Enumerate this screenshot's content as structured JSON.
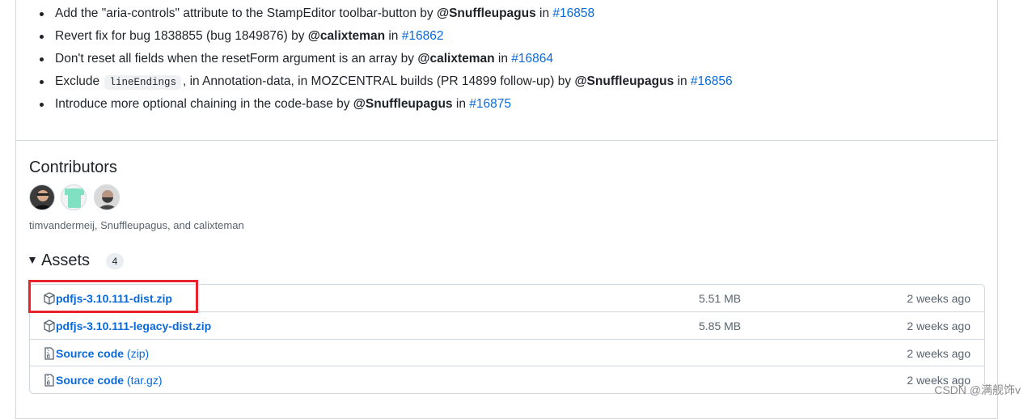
{
  "changes": [
    {
      "pre": "Add the \"aria-controls\" attribute to the StampEditor toolbar-button by ",
      "author": "@Snuffleupagus",
      "mid": " in ",
      "pr": "#16858"
    },
    {
      "pre": "Revert fix for bug 1838855 (bug 1849876) by ",
      "author": "@calixteman",
      "mid": " in ",
      "pr": "#16862"
    },
    {
      "pre": "Don't reset all fields when the resetForm argument is an array by ",
      "author": "@calixteman",
      "mid": " in ",
      "pr": "#16864"
    },
    {
      "pre": "Exclude ",
      "code": "lineEndings",
      "post": ", in Annotation-data, in MOZCENTRAL builds (PR 14899 follow-up) by ",
      "author": "@Snuffleupagus",
      "mid": " in ",
      "pr": "#16856"
    },
    {
      "pre": "Introduce more optional chaining in the code-base by ",
      "author": "@Snuffleupagus",
      "mid": " in ",
      "pr": "#16875"
    }
  ],
  "contributors": {
    "title": "Contributors",
    "names": "timvandermeij, Snuffleupagus, and calixteman",
    "avatars": [
      {
        "name": "timvandermeij",
        "color": "#2b2b2b"
      },
      {
        "name": "Snuffleupagus",
        "color": "#7fe0c2"
      },
      {
        "name": "calixteman",
        "color": "#5a5a5a"
      }
    ]
  },
  "assets": {
    "title": "Assets",
    "count": "4",
    "rows": [
      {
        "name": "pdfjs-3.10.111-dist.zip",
        "suffix": "",
        "size": "5.51 MB",
        "time": "2 weeks ago",
        "icon": "package-icon"
      },
      {
        "name": "pdfjs-3.10.111-legacy-dist.zip",
        "suffix": "",
        "size": "5.85 MB",
        "time": "2 weeks ago",
        "icon": "package-icon"
      },
      {
        "name": "Source code",
        "suffix": " (zip)",
        "size": "",
        "time": "2 weeks ago",
        "icon": "file-zip-icon"
      },
      {
        "name": "Source code",
        "suffix": " (tar.gz)",
        "size": "",
        "time": "2 weeks ago",
        "icon": "file-zip-icon"
      }
    ]
  },
  "watermark": "CSDN @满舰饰v",
  "colors": {
    "link": "#0969da",
    "highlight": "#e8232e",
    "border": "#d0d7de"
  }
}
